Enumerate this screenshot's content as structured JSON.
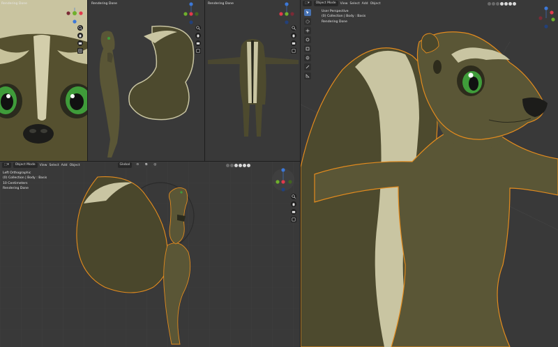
{
  "viewports": {
    "front": {
      "status": "Rendering Done"
    },
    "side": {
      "status": "Rendering Done"
    },
    "back": {
      "status": "Rendering Done"
    },
    "left": {
      "header": {
        "mode": "Object Mode",
        "menu": [
          "View",
          "Select",
          "Add",
          "Object"
        ],
        "orientation": "Global"
      },
      "overlay": {
        "view": "Left Orthographic",
        "collection": "(0) Collection | Body : Basis",
        "units": "10 Centimeters",
        "status": "Rendering Done"
      }
    },
    "user": {
      "header": {
        "mode": "Object Mode",
        "menu": [
          "View",
          "Select",
          "Add",
          "Object"
        ]
      },
      "overlay": {
        "view": "User Perspective",
        "collection": "(0) Collection | Body : Basis",
        "status": "Rendering Done"
      }
    }
  },
  "gizmo_axes": {
    "x": "X",
    "y": "Y",
    "z": "Z"
  },
  "icons": [
    "cursor-icon",
    "select-box-icon",
    "move-icon",
    "rotate-icon",
    "scale-icon",
    "transform-icon",
    "annotate-icon",
    "measure-icon",
    "zoom-icon",
    "hand-pan-icon",
    "camera-icon",
    "grid-view-icon"
  ],
  "colors": {
    "viewport_bg": "#393939",
    "model_body": "#5a5636",
    "model_stripe": "#c9c5a2",
    "selection_outline": "#e38b1e",
    "active_tool": "#4772b3",
    "eye_green": "#3f9c3a",
    "axis_x": "#e23a4c",
    "axis_y": "#6fb02c",
    "axis_z": "#3c78d8"
  }
}
